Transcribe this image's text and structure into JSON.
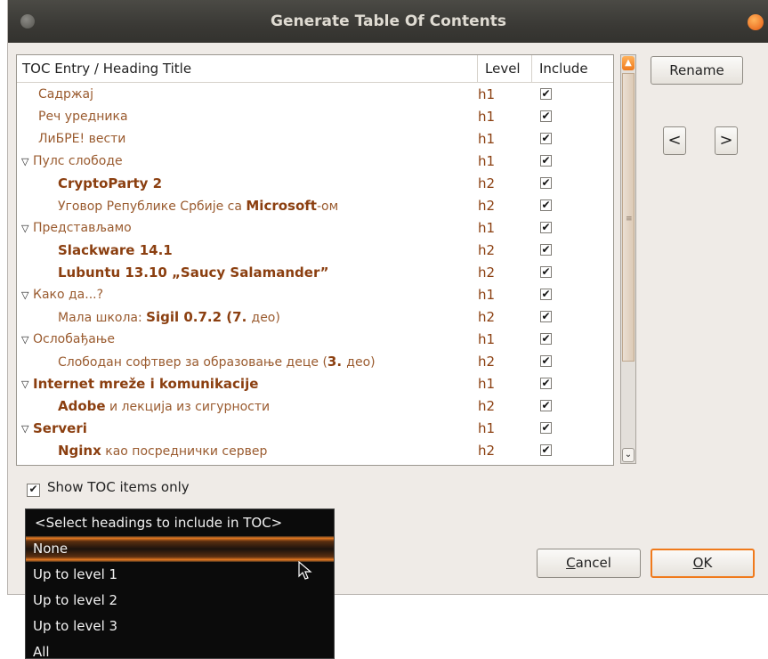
{
  "window": {
    "title": "Generate Table Of Contents"
  },
  "table": {
    "headers": {
      "title": "TOC Entry / Heading Title",
      "level": "Level",
      "include": "Include"
    },
    "rows": [
      {
        "indent": 1,
        "expander": false,
        "parts": [
          {
            "t": "Садржај",
            "l": false
          }
        ],
        "level": "h1",
        "include": true
      },
      {
        "indent": 1,
        "expander": false,
        "parts": [
          {
            "t": "Реч уредника",
            "l": false
          }
        ],
        "level": "h1",
        "include": true
      },
      {
        "indent": 1,
        "expander": false,
        "parts": [
          {
            "t": "ЛиБРЕ! вести",
            "l": false
          }
        ],
        "level": "h1",
        "include": true
      },
      {
        "indent": 0,
        "expander": true,
        "parts": [
          {
            "t": "Пулс слободе",
            "l": false
          }
        ],
        "level": "h1",
        "include": true
      },
      {
        "indent": 2,
        "expander": false,
        "parts": [
          {
            "t": "CryptoParty 2",
            "l": true
          }
        ],
        "level": "h2",
        "include": true
      },
      {
        "indent": 2,
        "expander": false,
        "parts": [
          {
            "t": "Уговор Републике Србије са ",
            "l": false
          },
          {
            "t": "Microsoft",
            "l": true
          },
          {
            "t": "-ом",
            "l": false
          }
        ],
        "level": "h2",
        "include": true
      },
      {
        "indent": 0,
        "expander": true,
        "parts": [
          {
            "t": "Представљамо",
            "l": false
          }
        ],
        "level": "h1",
        "include": true
      },
      {
        "indent": 2,
        "expander": false,
        "parts": [
          {
            "t": "Slackware 14.1",
            "l": true
          }
        ],
        "level": "h2",
        "include": true
      },
      {
        "indent": 2,
        "expander": false,
        "parts": [
          {
            "t": "Lubuntu 13.10 „Saucy Salamander”",
            "l": true
          }
        ],
        "level": "h2",
        "include": true
      },
      {
        "indent": 0,
        "expander": true,
        "parts": [
          {
            "t": "Како да...?",
            "l": false
          }
        ],
        "level": "h1",
        "include": true
      },
      {
        "indent": 2,
        "expander": false,
        "parts": [
          {
            "t": "Мала школа: ",
            "l": false
          },
          {
            "t": "Sigil 0.7.2 (7. ",
            "l": true
          },
          {
            "t": "део)",
            "l": false
          }
        ],
        "level": "h2",
        "include": true
      },
      {
        "indent": 0,
        "expander": true,
        "parts": [
          {
            "t": "Ослобађање",
            "l": false
          }
        ],
        "level": "h1",
        "include": true
      },
      {
        "indent": 2,
        "expander": false,
        "parts": [
          {
            "t": "Слободан софтвер за образовање деце (",
            "l": false
          },
          {
            "t": "3. ",
            "l": true
          },
          {
            "t": "део)",
            "l": false
          }
        ],
        "level": "h2",
        "include": true
      },
      {
        "indent": 0,
        "expander": true,
        "parts": [
          {
            "t": "Internet mreže i komunikacije",
            "l": true
          }
        ],
        "level": "h1",
        "include": true
      },
      {
        "indent": 2,
        "expander": false,
        "parts": [
          {
            "t": "Adobe",
            "l": true
          },
          {
            "t": " и лекција из сигурности",
            "l": false
          }
        ],
        "level": "h2",
        "include": true
      },
      {
        "indent": 0,
        "expander": true,
        "parts": [
          {
            "t": "Serveri",
            "l": true
          }
        ],
        "level": "h1",
        "include": true
      },
      {
        "indent": 2,
        "expander": false,
        "parts": [
          {
            "t": "Nginx",
            "l": true
          },
          {
            "t": " као посреднички сервер",
            "l": false
          }
        ],
        "level": "h2",
        "include": true
      }
    ]
  },
  "buttons": {
    "rename": "Rename",
    "move_left": "<",
    "move_right": ">",
    "cancel_pre": "",
    "cancel_u": "C",
    "cancel_post": "ancel",
    "ok_u": "O",
    "ok_post": "K"
  },
  "show_toc": {
    "label": "Show TOC items only",
    "checked": true
  },
  "dropdown": {
    "header": "<Select headings to include in TOC>",
    "items": [
      "None",
      "Up to level 1",
      "Up to level 2",
      "Up to level 3",
      "All"
    ],
    "selected_index": 0
  },
  "colors": {
    "accent": "#f07a1c",
    "heading_text": "#8b3f10"
  }
}
